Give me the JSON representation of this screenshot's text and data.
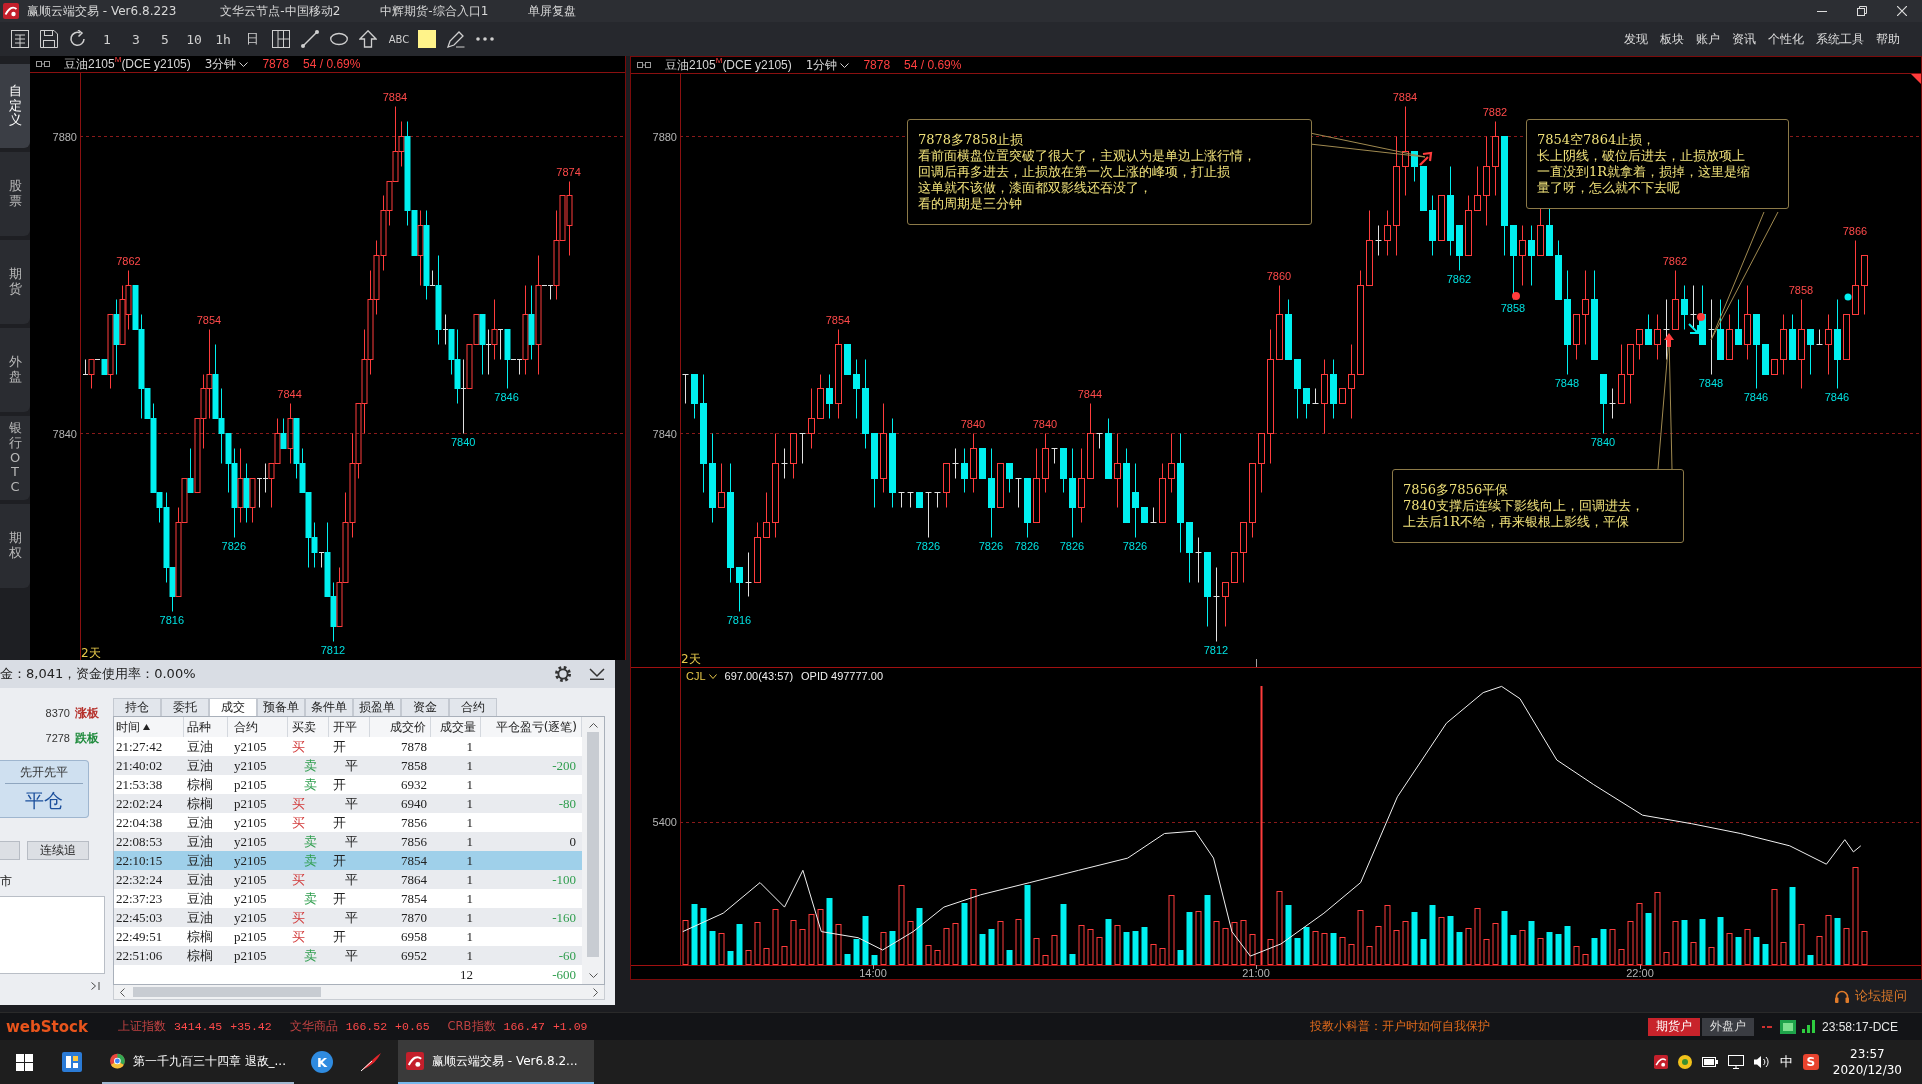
{
  "title_bar": {
    "app": "赢顺云端交易 - Ver6.8.223",
    "items": [
      "文华云节点-中国移动2",
      "中辉期货-综合入口1",
      "单屏复盘"
    ]
  },
  "toolbar": {
    "period_buttons": [
      "1",
      "3",
      "5",
      "10",
      "1h",
      "日"
    ],
    "text_tool": "ABC",
    "menu": [
      "发现",
      "板块",
      "账户",
      "资讯",
      "个性化",
      "系统工具",
      "帮助"
    ]
  },
  "side_tabs": [
    {
      "label": "自定义",
      "selected": true
    },
    {
      "label": "股票",
      "selected": false
    },
    {
      "label": "期货",
      "selected": false
    },
    {
      "label": "外盘",
      "selected": false
    },
    {
      "label": "银行OTC",
      "selected": false
    },
    {
      "label": "期权",
      "selected": false
    }
  ],
  "left_chart": {
    "symbol": "豆油2105$^{M}$(DCE y2105)",
    "period": "3分钟",
    "last_price": "7878",
    "change": "54 / 0.69%",
    "y_ticks": [
      "7880",
      "7840"
    ],
    "extreme_labels": [
      {
        "text": "7862",
        "kind": "high"
      },
      {
        "text": "7816",
        "kind": "low"
      },
      {
        "text": "7854",
        "kind": "high"
      },
      {
        "text": "7826",
        "kind": "low"
      },
      {
        "text": "7844",
        "kind": "high"
      },
      {
        "text": "7812",
        "kind": "low"
      },
      {
        "text": "7884",
        "kind": "high"
      },
      {
        "text": "7840",
        "kind": "low"
      },
      {
        "text": "7846",
        "kind": "low"
      },
      {
        "text": "7874",
        "kind": "high"
      }
    ],
    "day_marker": "2天"
  },
  "right_chart": {
    "symbol": "豆油2105$^{M}$(DCE y2105)",
    "period": "1分钟",
    "last_price": "7878",
    "change": "54 / 0.69%",
    "y_ticks": [
      "7880",
      "7840"
    ],
    "extreme_labels": [
      {
        "text": "7816",
        "kind": "low"
      },
      {
        "text": "7854",
        "kind": "high"
      },
      {
        "text": "7826",
        "kind": "low"
      },
      {
        "text": "7840",
        "kind": "high"
      },
      {
        "text": "7826",
        "kind": "low"
      },
      {
        "text": "7826",
        "kind": "low"
      },
      {
        "text": "7840",
        "kind": "high"
      },
      {
        "text": "7826",
        "kind": "low"
      },
      {
        "text": "7844",
        "kind": "high"
      },
      {
        "text": "7826",
        "kind": "low"
      },
      {
        "text": "7812",
        "kind": "low"
      },
      {
        "text": "7860",
        "kind": "high"
      },
      {
        "text": "7884",
        "kind": "high"
      },
      {
        "text": "7862",
        "kind": "low"
      },
      {
        "text": "7882",
        "kind": "high"
      },
      {
        "text": "7858",
        "kind": "low"
      },
      {
        "text": "7848",
        "kind": "low"
      },
      {
        "text": "7840",
        "kind": "low"
      },
      {
        "text": "7862",
        "kind": "high"
      },
      {
        "text": "7848",
        "kind": "low"
      },
      {
        "text": "7846",
        "kind": "low"
      },
      {
        "text": "7858",
        "kind": "high"
      },
      {
        "text": "7846",
        "kind": "low"
      },
      {
        "text": "7866",
        "kind": "high"
      }
    ],
    "day_marker": "2天",
    "annotations": [
      {
        "lines": [
          "7878多7858止损",
          "看前面横盘位置突破了很大了，主观认为是单边上涨行情，",
          "回调后再多进去，止损放在第一次上涨的峰项，打止损",
          "这单就不该做，漆面都双影线还吞没了，",
          "看的周期是三分钟"
        ]
      },
      {
        "lines": [
          "7854空7864止损，",
          "长上阴线，破位后进去，止损放项上",
          "一直没到1R就拿着，损掉，这里是缩",
          "量了呀，怎么就不下去呢"
        ]
      },
      {
        "lines": [
          "7856多7856平保",
          "7840支撑后连续下影线向上，回调进去，",
          "上去后1R不给，再来银根上影线，平保"
        ]
      }
    ],
    "volume_panel": {
      "indicator": "CJL",
      "reading": "697.00(43:57)",
      "open_interest": "OPID 497777.00",
      "y_ticks": [
        "5400"
      ]
    },
    "time_labels": [
      "14:00",
      "21:00",
      "22:00"
    ]
  },
  "order_panel": {
    "summary": "金：8,041，资金使用率：0.00%",
    "limit_up": {
      "price": "8370",
      "label": "涨板"
    },
    "limit_down": {
      "price": "7278",
      "label": "跌板"
    },
    "close_button": {
      "mode": "先开先平",
      "label": "平仓"
    },
    "chase_button": "连续追",
    "price_type": "市",
    "tabs": [
      {
        "label": "持仓",
        "selected": false
      },
      {
        "label": "委托",
        "selected": false
      },
      {
        "label": "成交",
        "selected": true
      },
      {
        "label": "预备单",
        "selected": false
      },
      {
        "label": "条件单",
        "selected": false
      },
      {
        "label": "损盈单",
        "selected": false
      },
      {
        "label": "资金",
        "selected": false
      },
      {
        "label": "合约",
        "selected": false
      }
    ],
    "columns": [
      {
        "label": "时间",
        "sorted": true
      },
      {
        "label": "品种",
        "sorted": false
      },
      {
        "label": "合约",
        "sorted": false
      },
      {
        "label": "买卖",
        "sorted": false
      },
      {
        "label": "开平",
        "sorted": false
      },
      {
        "label": "成交价",
        "sorted": false
      },
      {
        "label": "成交量",
        "sorted": false
      },
      {
        "label": "平仓盈亏(逐笔)",
        "sorted": false
      }
    ],
    "rows": [
      {
        "time": "21:27:42",
        "product": "豆油",
        "contract": "y2105",
        "side": {
          "text": "买",
          "kind": "buy"
        },
        "action": {
          "text": "开",
          "kind": "open"
        },
        "price": "7878",
        "qty": "1",
        "selected": false
      },
      {
        "time": "21:40:02",
        "product": "豆油",
        "contract": "y2105",
        "side": {
          "text": "卖",
          "kind": "sell"
        },
        "action": {
          "text": "平",
          "kind": "close"
        },
        "price": "7858",
        "qty": "1",
        "pnl": {
          "text": "-200",
          "kind": "loss"
        },
        "selected": false
      },
      {
        "time": "21:53:38",
        "product": "棕榈",
        "contract": "p2105",
        "side": {
          "text": "卖",
          "kind": "sell"
        },
        "action": {
          "text": "开",
          "kind": "open"
        },
        "price": "6932",
        "qty": "1",
        "selected": false
      },
      {
        "time": "22:02:24",
        "product": "棕榈",
        "contract": "p2105",
        "side": {
          "text": "买",
          "kind": "buy"
        },
        "action": {
          "text": "平",
          "kind": "close"
        },
        "price": "6940",
        "qty": "1",
        "pnl": {
          "text": "-80",
          "kind": "loss"
        },
        "selected": false
      },
      {
        "time": "22:04:38",
        "product": "豆油",
        "contract": "y2105",
        "side": {
          "text": "买",
          "kind": "buy"
        },
        "action": {
          "text": "开",
          "kind": "open"
        },
        "price": "7856",
        "qty": "1",
        "selected": false
      },
      {
        "time": "22:08:53",
        "product": "豆油",
        "contract": "y2105",
        "side": {
          "text": "卖",
          "kind": "sell"
        },
        "action": {
          "text": "平",
          "kind": "close"
        },
        "price": "7856",
        "qty": "1",
        "pnl": {
          "text": "0",
          "kind": "flat"
        },
        "selected": false
      },
      {
        "time": "22:10:15",
        "product": "豆油",
        "contract": "y2105",
        "side": {
          "text": "卖",
          "kind": "sell"
        },
        "action": {
          "text": "开",
          "kind": "open"
        },
        "price": "7854",
        "qty": "1",
        "selected": true
      },
      {
        "time": "22:32:24",
        "product": "豆油",
        "contract": "y2105",
        "side": {
          "text": "买",
          "kind": "buy"
        },
        "action": {
          "text": "平",
          "kind": "close"
        },
        "price": "7864",
        "qty": "1",
        "pnl": {
          "text": "-100",
          "kind": "loss"
        },
        "selected": false
      },
      {
        "time": "22:37:23",
        "product": "豆油",
        "contract": "y2105",
        "side": {
          "text": "卖",
          "kind": "sell"
        },
        "action": {
          "text": "开",
          "kind": "open"
        },
        "price": "7854",
        "qty": "1",
        "selected": false
      },
      {
        "time": "22:45:03",
        "product": "豆油",
        "contract": "y2105",
        "side": {
          "text": "买",
          "kind": "buy"
        },
        "action": {
          "text": "平",
          "kind": "close"
        },
        "price": "7870",
        "qty": "1",
        "pnl": {
          "text": "-160",
          "kind": "loss"
        },
        "selected": false
      },
      {
        "time": "22:49:51",
        "product": "棕榈",
        "contract": "p2105",
        "side": {
          "text": "买",
          "kind": "buy"
        },
        "action": {
          "text": "开",
          "kind": "open"
        },
        "price": "6958",
        "qty": "1",
        "selected": false
      },
      {
        "time": "22:51:06",
        "product": "棕榈",
        "contract": "p2105",
        "side": {
          "text": "卖",
          "kind": "sell"
        },
        "action": {
          "text": "平",
          "kind": "close"
        },
        "price": "6952",
        "qty": "1",
        "pnl": {
          "text": "-60",
          "kind": "loss"
        },
        "selected": false
      }
    ],
    "total": {
      "qty": "12",
      "pnl": {
        "text": "-600",
        "kind": "loss"
      }
    }
  },
  "forum_link": "论坛提问",
  "status_bar": {
    "logo": "webStock",
    "tickers": [
      {
        "name": "上证指数",
        "value": "3414.45",
        "change": "+35.42"
      },
      {
        "name": "文华商品",
        "value": "166.52",
        "change": "+0.65"
      },
      {
        "name": "CRB指数",
        "value": "166.47",
        "change": "+1.09"
      }
    ],
    "notice": "投教小科普：开户时如何自我保护",
    "account_tabs": [
      {
        "label": "期货户",
        "selected": true
      },
      {
        "label": "外盘户",
        "selected": false
      }
    ],
    "clock": "23:58:17-DCE"
  },
  "taskbar": {
    "windows": [
      {
        "kind": "browser",
        "title": "第一千九百三十四章 退敌_...",
        "selected": false
      },
      {
        "kind": "app",
        "title": "赢顺云端交易 - Ver6.8.2...",
        "selected": true
      }
    ],
    "pinned_apps": [
      {
        "kind": "letter",
        "glyph": "K"
      },
      {
        "kind": "feather"
      }
    ],
    "ime": "中",
    "ime_badge": "S",
    "time": "23:57",
    "date": "2020/12/30"
  }
}
